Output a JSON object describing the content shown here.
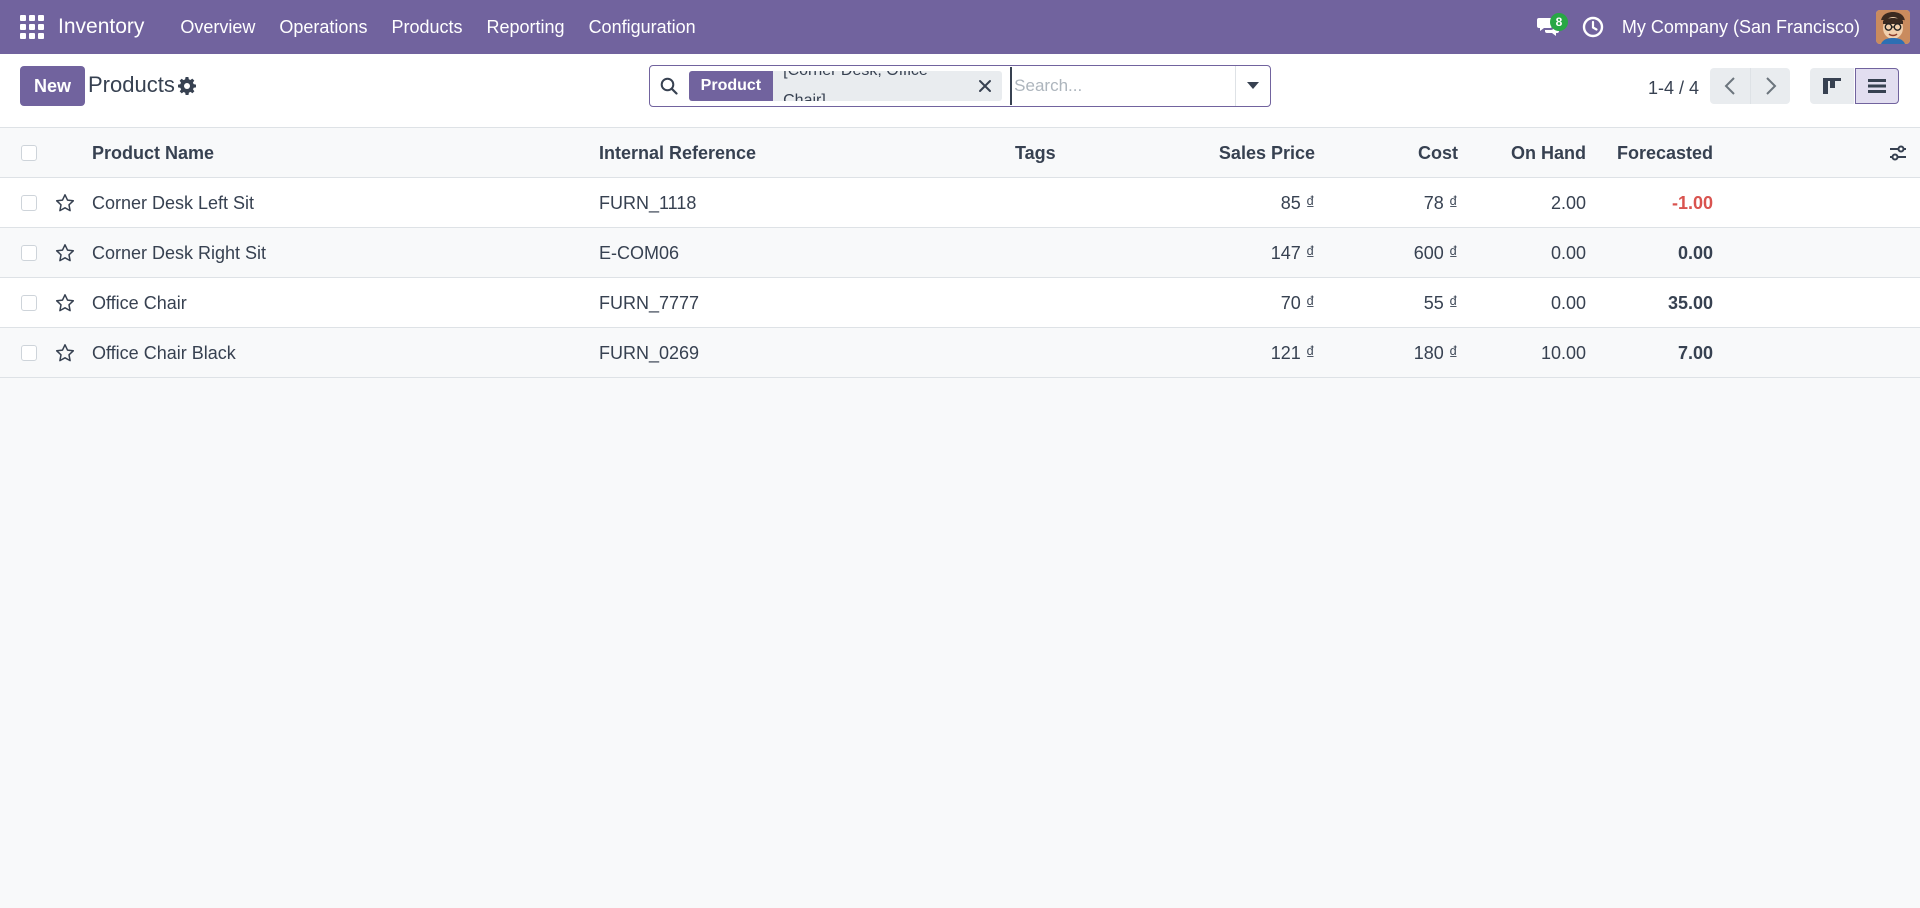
{
  "navbar": {
    "brand": "Inventory",
    "menu": [
      "Overview",
      "Operations",
      "Products",
      "Reporting",
      "Configuration"
    ],
    "chat_count": "8",
    "company": "My Company (San Francisco)",
    "accent": "#71639e"
  },
  "control": {
    "new_label": "New",
    "title": "Products",
    "search": {
      "facet_label": "Product",
      "facet_value": "[Corner Desk, Office Chair]",
      "placeholder": "Search...",
      "value": ""
    },
    "pager": "1-4 / 4"
  },
  "table": {
    "columns": {
      "name": "Product Name",
      "ref": "Internal Reference",
      "tags": "Tags",
      "sales": "Sales Price",
      "cost": "Cost",
      "onhand": "On Hand",
      "forecast": "Forecasted"
    },
    "rows": [
      {
        "name": "Corner Desk Left Sit",
        "ref": "FURN_1118",
        "tags": "",
        "sales": "85 ₫",
        "cost": "78 ₫",
        "onhand": "2.00",
        "forecast": "-1.00"
      },
      {
        "name": "Corner Desk Right Sit",
        "ref": "E-COM06",
        "tags": "",
        "sales": "147 ₫",
        "cost": "600 ₫",
        "onhand": "0.00",
        "forecast": "0.00"
      },
      {
        "name": "Office Chair",
        "ref": "FURN_7777",
        "tags": "",
        "sales": "70 ₫",
        "cost": "55 ₫",
        "onhand": "0.00",
        "forecast": "35.00"
      },
      {
        "name": "Office Chair Black",
        "ref": "FURN_0269",
        "tags": "",
        "sales": "121 ₫",
        "cost": "180 ₫",
        "onhand": "10.00",
        "forecast": "7.00"
      }
    ]
  }
}
